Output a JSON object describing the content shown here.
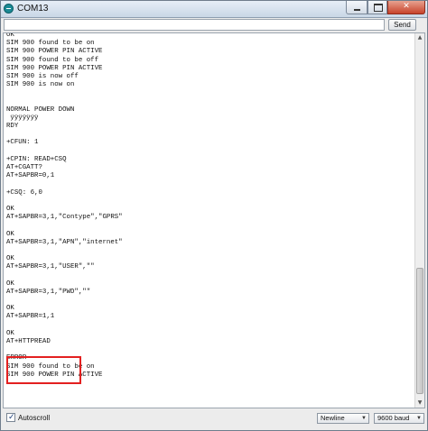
{
  "window": {
    "title": "COM13"
  },
  "send": {
    "input_value": "",
    "button_label": "Send"
  },
  "monitor": {
    "lines": [
      "OK",
      "SIM 900 found to be on",
      "SIM 900 POWER PIN ACTIVE",
      "SIM 900 found to be off",
      "SIM 900 POWER PIN ACTIVE",
      "SIM 900 is now off",
      "SIM 900 is now on",
      "",
      "",
      "NORMAL POWER DOWN",
      " ÿÿÿÿÿÿÿ",
      "RDY",
      "",
      "+CFUN: 1",
      "",
      "+CPIN: READ+CSQ",
      "AT+CGATT?",
      "AT+SAPBR=0,1",
      "",
      "+CSQ: 6,0",
      "",
      "OK",
      "AT+SAPBR=3,1,\"Contype\",\"GPRS\"",
      "",
      "OK",
      "AT+SAPBR=3,1,\"APN\",\"internet\"",
      "",
      "OK",
      "AT+SAPBR=3,1,\"USER\",\"\"",
      "",
      "OK",
      "AT+SAPBR=3,1,\"PWD\",\"\"",
      "",
      "OK",
      "AT+SAPBR=1,1",
      "",
      "OK",
      "AT+HTTPREAD",
      "",
      "ERROR",
      "SIM 900 found to be on",
      "SIM 900 POWER PIN ACTIVE"
    ]
  },
  "footer": {
    "autoscroll_label": "Autoscroll",
    "autoscroll_checked": true,
    "line_ending": "Newline",
    "baud": "9600 baud"
  },
  "colors": {
    "highlight": "#e32020"
  }
}
